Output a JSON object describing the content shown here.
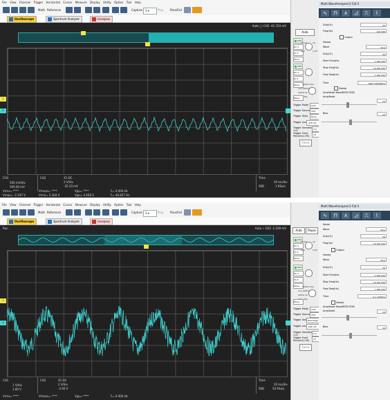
{
  "menu": [
    "File",
    "View",
    "Channel",
    "Trigger",
    "Horizontal",
    "Cursor",
    "Measure",
    "Display",
    "Utility",
    "Option",
    "Tool",
    "Help"
  ],
  "toolbar": {
    "math": "Math",
    "reference": "Reference",
    "capture": "Capture",
    "play": "Play",
    "pass_fail": "Pass/Fail"
  },
  "tabs": [
    "Oscilloscope",
    "Spectrum Analyzer",
    "Lissajous"
  ],
  "panel1": {
    "mode": "",
    "status": "Auto",
    "readout": "CH2 -41.724 mV",
    "ch1": {
      "label": "CH1",
      "scale": "500 mV/div",
      "offset": "500.00 mV"
    },
    "ch2": {
      "label": "CH2",
      "coupling": "X1 DC",
      "scale": "2 V/div",
      "offset": "-35.33 mV"
    },
    "time": {
      "label": "Time",
      "scale": "50 ms/div",
      "samples": "5KB",
      "rate": "1 KSa/s"
    },
    "meas": {
      "vrms": "Vrms= ****",
      "vmean": "Vmean= ****",
      "vpp": "Vpp= ****",
      "f": "F= 0.000 Hz",
      "vmax": "Vmax= -2.197 V",
      "vmin": "Vmin= 2.264 V",
      "vpp2": "Vpp= 4.458 V",
      "f2": "F= 40.857 Hz"
    },
    "wf_title": "Multi WaveAnalyzer(1-5)4.5",
    "scope": {
      "auto": "Auto",
      "ch1": "CH1",
      "ch2": "CH2",
      "dc": "DC",
      "x1": "X1",
      "move": "Move",
      "v1": "10mV",
      "v2": "1V",
      "v3": "10V",
      "v4": "1.0V",
      "t1": "100us 1ms",
      "t2": "1us 100ms",
      "t3": "100ns 1s",
      "t4": "10ns 10s"
    },
    "trigger": {
      "mode_l": "Trigger Mode",
      "mode": "Auto",
      "source_l": "Trigger Source",
      "source": "CH2",
      "style_l": "Trigger Style",
      "style": "None",
      "level_l": "Trigger Level",
      "level": "-333 mV",
      "sens_l": "Trigger Sensitivity(0-1.0)",
      "sens": "0.4",
      "pos_l": "Trigger Front Percent(1-99)",
      "pos": "10",
      "force": "Force"
    },
    "gen": {
      "duty_l": "Duty(%)",
      "duty": "50",
      "freq_l": "Freq(Hz)",
      "freq": "100 000",
      "output": "Output",
      "sweep": "Sweep",
      "wave_l": "Wave",
      "wave": "Sine",
      "duty2_l": "Duty(%)",
      "duty2": "50",
      "start_l": "Start Freq(Hz)",
      "start": "1 000 000",
      "stop_l": "Stop Freq(Hz)",
      "stop": "10 000 000",
      "step_l": "Freq Step(Hz)",
      "step": "1 000 000",
      "time_l": "Time",
      "time": "1000 100000ms",
      "sweep2": "Sweep",
      "amp_l": "Amplitude Base(REDCODE)",
      "amp2_l": "Amplitude",
      "amp": "29",
      "bias_l": "Bias",
      "bias": "10"
    }
  },
  "panel2": {
    "mode": "Run",
    "status": "Auto",
    "readout": "CH2 -1.109 mV",
    "ch1": {
      "label": "CH1",
      "scale": "1 V/div",
      "offset": "1.00 V"
    },
    "ch2": {
      "label": "CH2",
      "coupling": "X1 DC",
      "scale": "2 V/div",
      "offset": "-2.00 V"
    },
    "time": {
      "label": "Time",
      "scale": "20 ms/div",
      "samples": "5KB",
      "rate": "50 KSa/s"
    },
    "meas": {
      "vrms": "Vrms= ****",
      "vmean": "Vmean= ****",
      "vpp": "Vpp= ****",
      "f": "F= 0.000 Hz"
    },
    "wf_title": "Multi WaveAnalyzer(1-5)4.5",
    "scope": {
      "auto": "Auto",
      "pause": "Pause",
      "ch1": "CH1",
      "ch2": "CH2",
      "dc": "DC",
      "x1": "X1",
      "move": "Move",
      "v1": "10mV",
      "v2": "1V",
      "v3": "10V",
      "v4": "1.0V",
      "t1": "500us 1ms",
      "t2": "1us 100ms",
      "t3": "100ns 1s",
      "t4": "10ns 10s"
    },
    "trigger": {
      "mode_l": "Trigger Mode",
      "mode": "Auto",
      "source_l": "Trigger Source",
      "source": "CH2",
      "style_l": "Trigger Style",
      "style": "Rise Edge",
      "level_l": "Trigger Level",
      "level": "-500 mV",
      "sens_l": "Trigger Sensitivity(0-1.0)",
      "sens": "0.4",
      "pos_l": "Trigger Front Percent(1-99)",
      "pos": "10",
      "force": "Force"
    },
    "gen": {
      "name_l": "Name",
      "name": "Sine",
      "duty_l": "Duty(%)",
      "duty": "50",
      "freq_l": "Freq(Hz)",
      "freq": "10 100 000",
      "output": "Output",
      "sweep": "Sweep",
      "wave_l": "Wave",
      "wave": "Sine",
      "duty2_l": "Duty(%)",
      "duty2": "50",
      "start_l": "Start Freq(Hz)",
      "start": "1 000 000",
      "stop_l": "Stop Freq(Hz)",
      "stop": "10 100 000",
      "step_l": "Freq Step(Hz)",
      "step": "1 000 000",
      "time_l": "Time",
      "time": "0.1 1000ms",
      "sweep2": "Sweep",
      "amp_l": "Amplitude Base(REDCODE)",
      "amp2_l": "Amplitude",
      "amp": "29",
      "bias_l": "Bias",
      "bias": "10"
    }
  },
  "colors": {
    "trace": "#3fd2d0",
    "ch1": "#efe547",
    "bg": "#242424"
  }
}
